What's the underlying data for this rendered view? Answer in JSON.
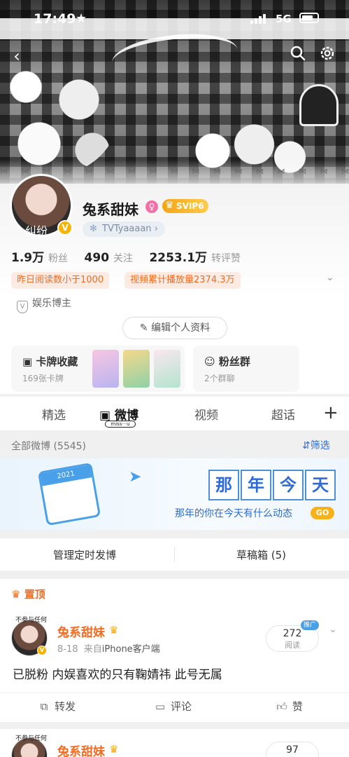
{
  "status_bar": {
    "time": "17:49",
    "network": "5G"
  },
  "profile": {
    "name": "兔系甜妹",
    "vip_label": "SVIP6",
    "handle": "TVTyaaaan",
    "avatar_caption": "纠纷",
    "stats": [
      {
        "value": "1.9万",
        "label": "粉丝"
      },
      {
        "value": "490",
        "label": "关注"
      },
      {
        "value": "2253.1万",
        "label": "转评赞"
      }
    ],
    "tags": [
      "昨日阅读数小于1000",
      "视频累计播放量2374.3万"
    ],
    "verification": "娱乐博主",
    "edit_button": "编辑个人资料"
  },
  "cards": {
    "card_collection": {
      "title": "卡牌收藏",
      "subtitle": "169张卡牌"
    },
    "fan_group": {
      "title": "粉丝群",
      "subtitle": "2个群聊"
    }
  },
  "tabs": [
    "精选",
    "微博",
    "视频",
    "超话"
  ],
  "tab_badge": "miss···u",
  "weibo_header": {
    "count": "全部微博 (5545)",
    "filter": "筛选"
  },
  "promo": {
    "title_chars": [
      "那",
      "年",
      "今",
      "天"
    ],
    "subtitle": "那年的你在今天有什么动态",
    "go": "GO",
    "calendar_year": "2021"
  },
  "manage": {
    "scheduled": "管理定时发博",
    "drafts": "草稿箱 (5)"
  },
  "pinned_label": "置顶",
  "post": {
    "author": "兔系甜妹",
    "avatar_caption": "不参与任何",
    "date": "8-18",
    "source_prefix": "来自",
    "source": "iPhone客户端",
    "reads_value": "272",
    "reads_label": "阅读",
    "promote_label": "推广",
    "text": "已脱粉 内娱喜欢的只有鞠婧祎 此号无属",
    "actions": {
      "repost": "转发",
      "comment": "评论",
      "like": "赞"
    }
  },
  "post2": {
    "author": "兔系甜妹",
    "avatar_caption": "不参与任何",
    "reads_value": "97"
  }
}
